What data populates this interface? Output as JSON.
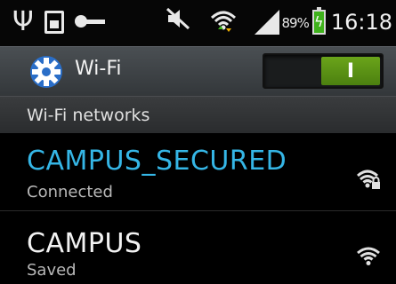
{
  "status_bar": {
    "icons": [
      "usb-icon",
      "sim-icon",
      "key-icon",
      "mute-icon",
      "wifi-icon",
      "signal-icon",
      "battery-icon"
    ],
    "battery_percent": "89%",
    "time": "16:18",
    "battery_color": "#3fb21c"
  },
  "title_bar": {
    "icon": "gear-icon",
    "title": "Wi-Fi",
    "toggle_label": "I",
    "toggle_state": "on",
    "toggle_color": "#5d9518"
  },
  "section": {
    "label": "Wi-Fi networks"
  },
  "networks": [
    {
      "name": "CAMPUS_SECURED",
      "status": "Connected",
      "secured": true,
      "icon": "wifi-lock-icon",
      "name_color": "#35b6e6"
    },
    {
      "name": "CAMPUS",
      "status": "Saved",
      "secured": false,
      "icon": "wifi-icon",
      "name_color": "#f2f2f2"
    }
  ]
}
